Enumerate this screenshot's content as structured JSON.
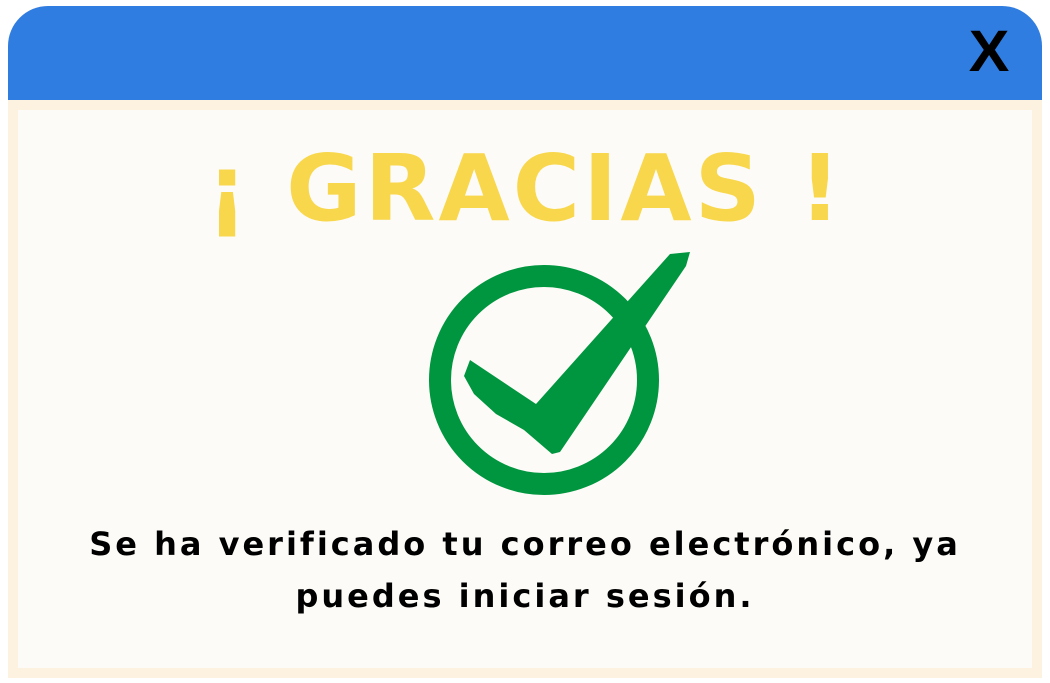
{
  "dialog": {
    "close_label": "X",
    "heading": "¡ GRACIAS !",
    "message": "Se ha verificado tu correo electrónico, ya puedes iniciar sesión.",
    "icon": "check-circle-icon"
  },
  "colors": {
    "titlebar": "#2f7de1",
    "heading": "#f8d74c",
    "check": "#00963f",
    "panel": "#fdfbf7",
    "border": "#fdf2e0"
  }
}
